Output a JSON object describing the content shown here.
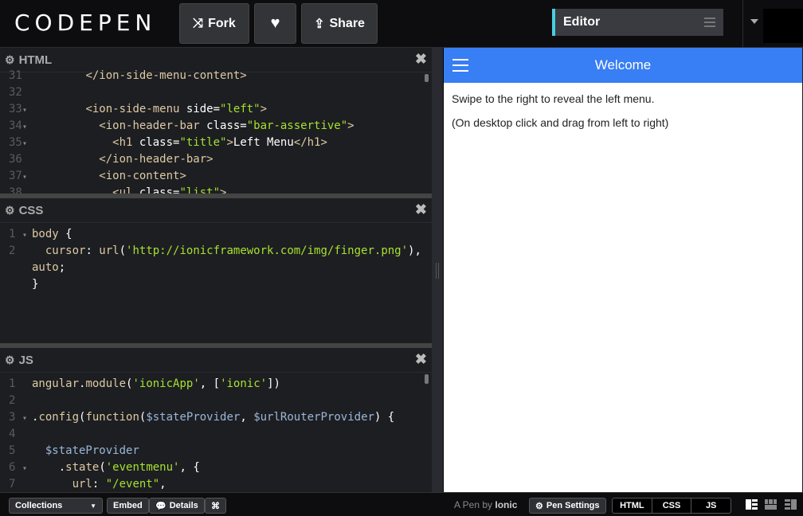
{
  "header": {
    "logo_text": "CODEPEN",
    "fork_label": "Fork",
    "share_label": "Share",
    "editor_view_label": "Editor",
    "colors": {
      "accent": "#47cfe0",
      "background": "#0d0d0f"
    }
  },
  "panes": {
    "html": {
      "title": "HTML",
      "lines": [
        {
          "n": "31",
          "fold": false,
          "parts": [
            [
              "plain",
              "        "
            ],
            [
              "tag",
              "</ion-side-menu-content>"
            ]
          ]
        },
        {
          "n": "32",
          "fold": false,
          "parts": []
        },
        {
          "n": "33",
          "fold": true,
          "parts": [
            [
              "plain",
              "        "
            ],
            [
              "tag",
              "<ion-side-menu "
            ],
            [
              "attr",
              "side="
            ],
            [
              "str",
              "\"left\""
            ],
            [
              "tag",
              ">"
            ]
          ]
        },
        {
          "n": "34",
          "fold": true,
          "parts": [
            [
              "plain",
              "          "
            ],
            [
              "tag",
              "<ion-header-bar "
            ],
            [
              "attr",
              "class="
            ],
            [
              "str",
              "\"bar-assertive\""
            ],
            [
              "tag",
              ">"
            ]
          ]
        },
        {
          "n": "35",
          "fold": true,
          "parts": [
            [
              "plain",
              "            "
            ],
            [
              "tag",
              "<h1 "
            ],
            [
              "attr",
              "class="
            ],
            [
              "str",
              "\"title\""
            ],
            [
              "tag",
              ">"
            ],
            [
              "plain",
              "Left Menu"
            ],
            [
              "tag",
              "</h1>"
            ]
          ]
        },
        {
          "n": "36",
          "fold": false,
          "parts": [
            [
              "plain",
              "          "
            ],
            [
              "tag",
              "</ion-header-bar>"
            ]
          ]
        },
        {
          "n": "37",
          "fold": true,
          "parts": [
            [
              "plain",
              "          "
            ],
            [
              "tag",
              "<ion-content>"
            ]
          ]
        },
        {
          "n": "38",
          "fold": false,
          "parts": [
            [
              "plain",
              "            "
            ],
            [
              "tag",
              "<ul "
            ],
            [
              "attr",
              "class="
            ],
            [
              "str",
              "\"list\""
            ],
            [
              "tag",
              ">"
            ]
          ]
        }
      ]
    },
    "css": {
      "title": "CSS",
      "lines": [
        {
          "n": "1",
          "fold": true,
          "parts": [
            [
              "kw",
              "body"
            ],
            [
              "plain",
              " {"
            ]
          ]
        },
        {
          "n": "2",
          "fold": false,
          "parts": [
            [
              "plain",
              "  "
            ],
            [
              "prop",
              "cursor"
            ],
            [
              "plain",
              ": "
            ],
            [
              "fn",
              "url"
            ],
            [
              "plain",
              "("
            ],
            [
              "str",
              "'http://ionicframework.com/img/finger.png'"
            ],
            [
              "plain",
              "),"
            ]
          ]
        },
        {
          "n": "",
          "fold": false,
          "parts": [
            [
              "prop",
              "auto"
            ],
            [
              "plain",
              ";"
            ]
          ]
        },
        {
          "n": "",
          "fold": false,
          "parts": [
            [
              "plain",
              "}"
            ]
          ]
        }
      ]
    },
    "js": {
      "title": "JS",
      "lines": [
        {
          "n": "1",
          "fold": false,
          "parts": [
            [
              "fn",
              "angular"
            ],
            [
              "plain",
              "."
            ],
            [
              "fn",
              "module"
            ],
            [
              "plain",
              "("
            ],
            [
              "str",
              "'ionicApp'"
            ],
            [
              "plain",
              ", ["
            ],
            [
              "str",
              "'ionic'"
            ],
            [
              "plain",
              "])"
            ]
          ]
        },
        {
          "n": "2",
          "fold": false,
          "parts": []
        },
        {
          "n": "3",
          "fold": true,
          "parts": [
            [
              "plain",
              "."
            ],
            [
              "fn",
              "config"
            ],
            [
              "plain",
              "("
            ],
            [
              "kw",
              "function"
            ],
            [
              "plain",
              "("
            ],
            [
              "var",
              "$stateProvider"
            ],
            [
              "plain",
              ", "
            ],
            [
              "var",
              "$urlRouterProvider"
            ],
            [
              "plain",
              ") {"
            ]
          ]
        },
        {
          "n": "4",
          "fold": false,
          "parts": []
        },
        {
          "n": "5",
          "fold": false,
          "parts": [
            [
              "plain",
              "  "
            ],
            [
              "var",
              "$stateProvider"
            ]
          ]
        },
        {
          "n": "6",
          "fold": true,
          "parts": [
            [
              "plain",
              "    ."
            ],
            [
              "fn",
              "state"
            ],
            [
              "plain",
              "("
            ],
            [
              "str",
              "'eventmenu'"
            ],
            [
              "plain",
              ", {"
            ]
          ]
        },
        {
          "n": "7",
          "fold": false,
          "parts": [
            [
              "plain",
              "      "
            ],
            [
              "prop",
              "url"
            ],
            [
              "plain",
              ": "
            ],
            [
              "str",
              "\"/event\""
            ],
            [
              "plain",
              ","
            ]
          ]
        }
      ]
    }
  },
  "preview": {
    "header_title": "Welcome",
    "paragraphs": [
      "Swipe to the right to reveal the left menu.",
      "(On desktop click and drag from left to right)"
    ],
    "header_color": "#387ef5"
  },
  "footer": {
    "collections_label": "Collections",
    "embed_label": "Embed",
    "details_label": "Details",
    "shortcut_label": "⌘",
    "pen_by_prefix": "A Pen by",
    "pen_by_author": "Ionic",
    "pen_settings_label": "Pen Settings",
    "view_tabs": [
      "HTML",
      "CSS",
      "JS"
    ]
  }
}
